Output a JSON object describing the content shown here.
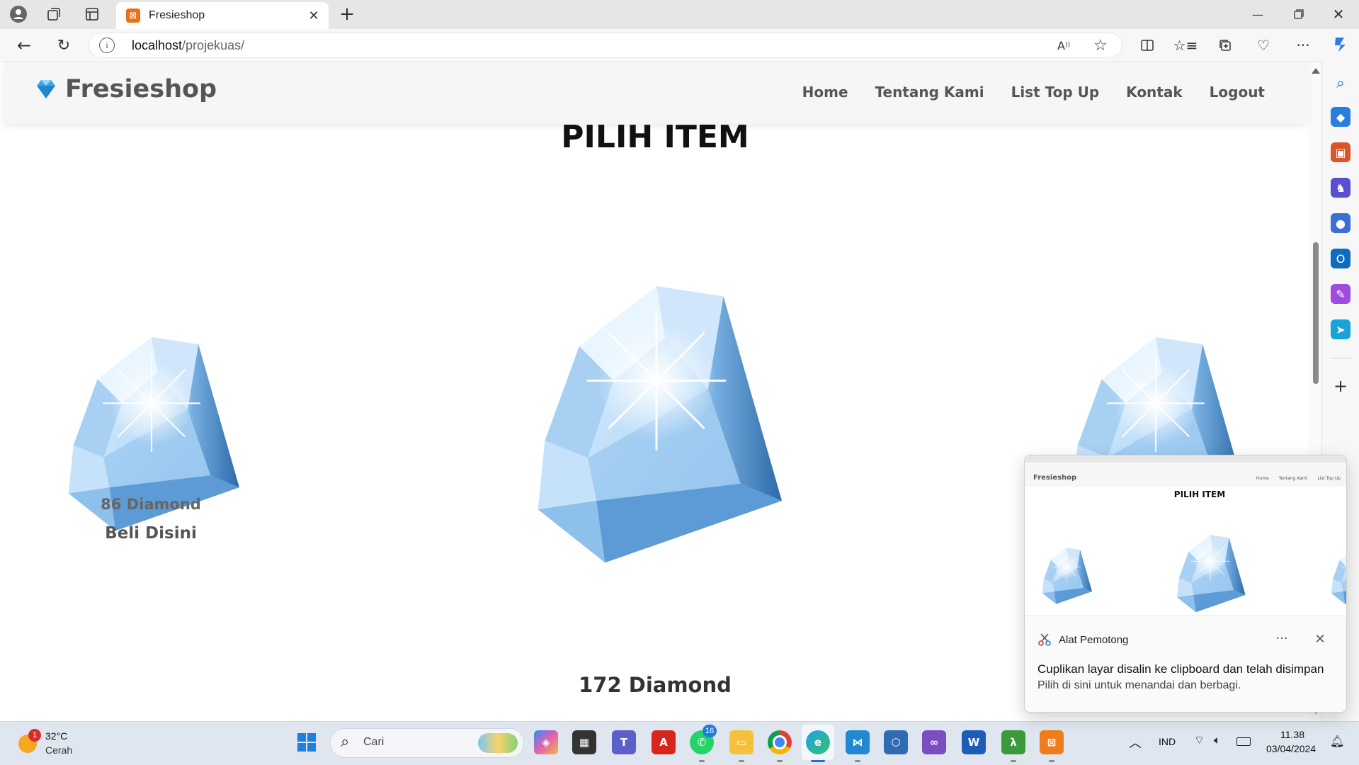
{
  "browser": {
    "tab_title": "Fresieshop",
    "url_host": "localhost",
    "url_path": "/projekuas/"
  },
  "site": {
    "brand": "Fresieshop",
    "nav": [
      "Home",
      "Tentang Kami",
      "List Top Up",
      "Kontak",
      "Logout"
    ],
    "page_title": "PILIH ITEM",
    "products": [
      {
        "name": "86 Diamond",
        "cta": "Beli Disini"
      },
      {
        "name": "172 Diamond"
      }
    ]
  },
  "notification": {
    "preview": {
      "brand": "Fresieshop",
      "nav": [
        "Home",
        "Tentang Kami",
        "List Top Up"
      ],
      "title": "PILIH ITEM"
    },
    "app_name": "Alat Pemotong",
    "message": "Cuplikan layar disalin ke clipboard dan telah disimpan",
    "sub_message": "Pilih di sini untuk menandai dan berbagi."
  },
  "taskbar": {
    "weather_temp": "32°C",
    "weather_desc": "Cerah",
    "weather_badge": "1",
    "search_placeholder": "Cari",
    "whatsapp_badge": "16",
    "language": "IND",
    "time": "11.38",
    "date": "03/04/2024"
  },
  "colors": {
    "brand_text": "#555555",
    "diamond_light": "#dbeeff",
    "diamond_mid": "#8fc2ee",
    "diamond_dark": "#2e6fae",
    "edge_accent": "#0c59b4"
  }
}
